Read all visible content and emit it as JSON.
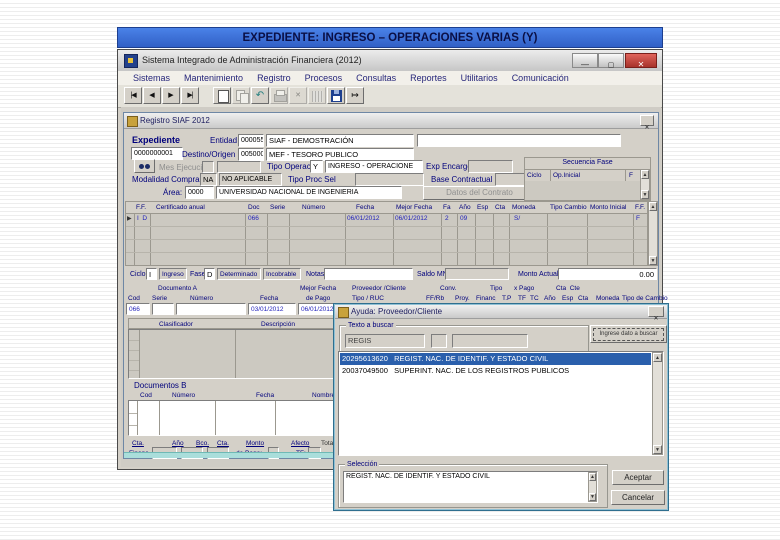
{
  "slide": {
    "title": "EXPEDIENTE: INGRESO – OPERACIONES VARIAS (Y)"
  },
  "colors": {
    "banner_blue": "#3b74d9",
    "selection_blue": "#2a5fac",
    "close_red": "#c0392f",
    "teal_strip": "#aadedb"
  },
  "window": {
    "title": "Sistema Integrado de Administración Financiera (2012)",
    "menu": [
      "Sistemas",
      "Mantenimiento",
      "Registro",
      "Procesos",
      "Consultas",
      "Reportes",
      "Utilitarios",
      "Comunicación"
    ],
    "toolbar_icons": [
      "first-record",
      "prev-record",
      "next-record",
      "last-record",
      "new-document",
      "copy",
      "undo",
      "print",
      "delete",
      "grid",
      "save",
      "exit"
    ]
  },
  "registro": {
    "title": "Registro SIAF 2012",
    "expediente": {
      "label": "Expediente",
      "value": "0000000001"
    },
    "entidad": {
      "label": "Entidad",
      "code": "000055",
      "name": "SIAF - DEMOSTRACIÓN"
    },
    "destino": {
      "label": "Destino/Origen",
      "code": "005000",
      "name": "MEF - TESORO PUBLICO"
    },
    "mes_ejecucion_label": "Mes Ejecución",
    "tipo_operacion": {
      "label": "Tipo Operación",
      "code": "Y",
      "name": "INGRESO - OPERACIONE"
    },
    "exp_encargo_label": "Exp Encargo",
    "modalidad": {
      "label": "Modalidad Compra",
      "code": "NA",
      "name": "NO APLICABLE"
    },
    "tipo_proc_label": "Tipo Proc Sel",
    "base_label": "Base Contractual",
    "area": {
      "label": "Área:",
      "code": "0000",
      "name": "UNIVERSIDAD NACIONAL DE INGENIERIA"
    },
    "datos_contrato": "Datos del Contrato",
    "secuencia": {
      "title": "Secuencia Fase",
      "col_ciclo": "Ciclo",
      "col_op": "Op.Inicial",
      "col_f": "F"
    },
    "table1": {
      "h": [
        "F.F.",
        "Certificado anual",
        "Doc",
        "Serie",
        "Número",
        "Fecha",
        "Mejor Fecha",
        "Fa",
        "Año",
        "Esp",
        "Cta",
        "Moneda",
        "Tipo Cambio",
        "Monto Inicial",
        "F.F."
      ],
      "r": [
        "I  D",
        "",
        "066",
        "",
        "",
        "06/01/2012",
        "06/01/2012",
        "2",
        "09",
        "",
        "",
        "S/",
        "",
        "",
        "F"
      ]
    },
    "fase": {
      "ciclo_label": "Ciclo",
      "ciclo": "I",
      "ciclo_name": "Ingreso",
      "fase_label": "Fase",
      "fase": "D",
      "fase_name": "Determinado",
      "extra": "Incobrable",
      "notas_label": "Notas",
      "saldo_label": "Saldo MN",
      "monto_label": "Monto Actual",
      "monto_value": "0.00"
    },
    "table2": {
      "groups": [
        "Documento A",
        "Mejor Fecha",
        "Proveedor /Cliente",
        "Conv.",
        "Tipo",
        "x Pago",
        "Cta  Cte"
      ],
      "h": [
        "Cod",
        "Serie",
        "Número",
        "Fecha",
        "de Pago",
        "Tipo / RUC",
        "FF/Rb",
        "Proy.",
        "Financ",
        "T.P",
        "TF",
        "TC",
        "Año",
        "Esp",
        "Cta",
        "Moneda",
        "Tipo de Cambio"
      ],
      "r": {
        "cod": "066",
        "fecha": "03/01/2012",
        "de_pago": "06/01/2012"
      }
    },
    "clasif": {
      "col1": "Clasificador",
      "col2": "Descripción"
    },
    "docsb": {
      "title": "Documentos B",
      "h": [
        "Cod",
        "Número",
        "Fecha",
        "Nombre/Girado"
      ]
    },
    "bottom": {
      "cta1": "Cta.",
      "cta2": "Financ.",
      "anio": "Año",
      "bco": "Bco.",
      "cta": "Cta.",
      "monto1": "Monto",
      "monto2": "de Pago:",
      "afecto1": "Afecto",
      "afecto2": "TF:",
      "total": "Total"
    }
  },
  "ayuda": {
    "title": "Ayuda: Proveedor/Cliente",
    "texto_label": "Texto a buscar",
    "texto_value": "REGIS",
    "buscar_button": "Ingrese dato a buscar",
    "rows": [
      "20295613620   REGIST. NAC. DE IDENTIF. Y ESTADO CIVIL",
      "20037049500   SUPERINT. NAC. DE LOS REGISTROS PUBLICOS"
    ],
    "seleccion_label": "Selección",
    "seleccion_value": "REGIST. NAC. DE IDENTIF. Y ESTADO CIVIL",
    "aceptar": "Aceptar",
    "cancelar": "Cancelar"
  }
}
